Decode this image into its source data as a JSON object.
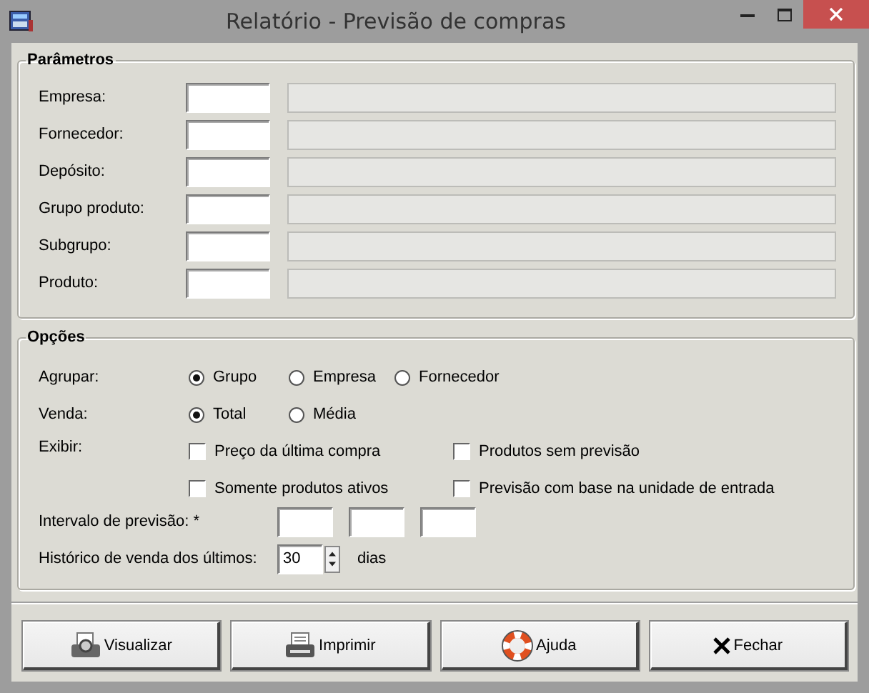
{
  "window": {
    "title": "Relatório - Previsão de compras"
  },
  "parameters": {
    "title": "Parâmetros",
    "fields": [
      {
        "label": "Empresa:"
      },
      {
        "label": "Fornecedor:"
      },
      {
        "label": "Depósito:"
      },
      {
        "label": "Grupo produto:"
      },
      {
        "label": "Subgrupo:"
      },
      {
        "label": "Produto:"
      }
    ]
  },
  "options": {
    "title": "Opções",
    "radio_groups": [
      {
        "label": "Agrupar:",
        "options": [
          {
            "label": "Grupo",
            "selected": true
          },
          {
            "label": "Empresa",
            "selected": false
          },
          {
            "label": "Fornecedor",
            "selected": false
          }
        ]
      },
      {
        "label": "Venda:",
        "options": [
          {
            "label": "Total",
            "selected": true
          },
          {
            "label": "Média",
            "selected": false
          }
        ]
      }
    ],
    "show": {
      "label": "Exibir:",
      "checkboxes": [
        {
          "label": "Preço da última compra",
          "checked": false
        },
        {
          "label": "Produtos sem previsão",
          "checked": false
        },
        {
          "label": "Somente produtos ativos",
          "checked": false
        },
        {
          "label": "Previsão com base na unidade de entrada",
          "checked": false
        }
      ]
    },
    "interval": {
      "label": "Intervalo de previsão: *"
    },
    "history": {
      "label": "Histórico de venda dos últimos:",
      "value": "30",
      "unit": "dias"
    }
  },
  "buttons": [
    {
      "label": "Visualizar",
      "kind": "preview"
    },
    {
      "label": "Imprimir",
      "kind": "print"
    },
    {
      "label": "Ajuda",
      "kind": "help"
    },
    {
      "label": "Fechar",
      "kind": "close"
    }
  ]
}
